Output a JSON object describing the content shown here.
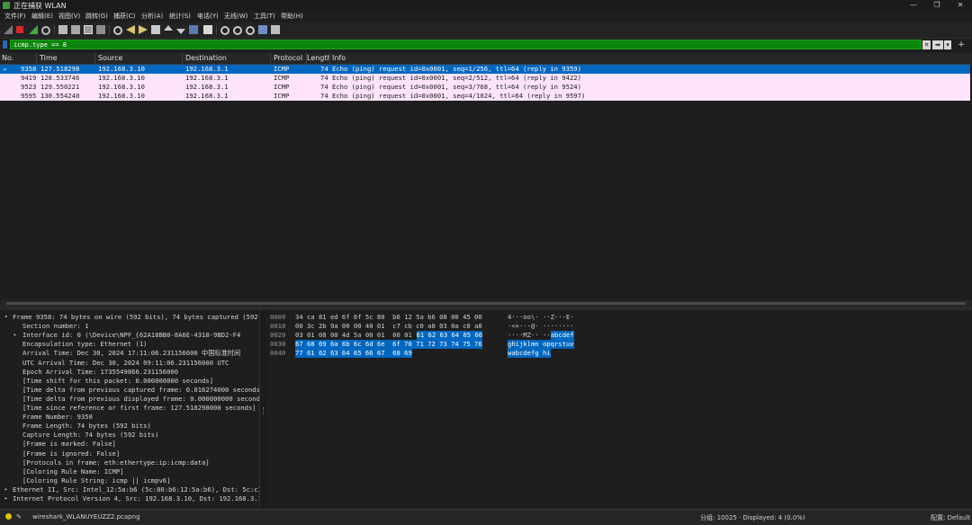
{
  "window": {
    "title": "正在捕获 WLAN",
    "min": "—",
    "max": "❐",
    "close": "✕"
  },
  "menu": [
    "文件(F)",
    "编辑(E)",
    "视图(V)",
    "跳转(G)",
    "捕获(C)",
    "分析(A)",
    "统计(S)",
    "电话(Y)",
    "无线(W)",
    "工具(T)",
    "帮助(H)"
  ],
  "filter": {
    "value": "icmp.type == 8",
    "clear_label": "✕",
    "apply_label": "➡",
    "dropdown_label": "▾",
    "add_label": "+"
  },
  "packet_list": {
    "columns": [
      "No.",
      "Time",
      "Source",
      "Destination",
      "Protocol",
      "Length",
      "Info"
    ],
    "rows": [
      {
        "marker": "→",
        "no": "9358",
        "time": "127.518298",
        "source": "192.168.3.10",
        "destination": "192.168.3.1",
        "protocol": "ICMP",
        "length": "74",
        "info": "Echo (ping) request  id=0x0001, seq=1/256, ttl=64 (reply in 9359)"
      },
      {
        "marker": "",
        "no": "9419",
        "time": "128.533746",
        "source": "192.168.3.10",
        "destination": "192.168.3.1",
        "protocol": "ICMP",
        "length": "74",
        "info": "Echo (ping) request  id=0x0001, seq=2/512, ttl=64 (reply in 9422)"
      },
      {
        "marker": "",
        "no": "9523",
        "time": "129.550221",
        "source": "192.168.3.10",
        "destination": "192.168.3.1",
        "protocol": "ICMP",
        "length": "74",
        "info": "Echo (ping) request  id=0x0001, seq=3/768, ttl=64 (reply in 9524)"
      },
      {
        "marker": "",
        "no": "9595",
        "time": "130.554240",
        "source": "192.168.3.10",
        "destination": "192.168.3.1",
        "protocol": "ICMP",
        "length": "74",
        "info": "Echo (ping) request  id=0x0001, seq=4/1024, ttl=64 (reply in 9597)"
      }
    ]
  },
  "details": [
    {
      "arrow": "▾",
      "indent": 0,
      "text": "Frame 9358: 74 bytes on wire (592 bits), 74 bytes captured (592 bits) on interface"
    },
    {
      "arrow": "",
      "indent": 1,
      "text": "Section number: 1"
    },
    {
      "arrow": "▸",
      "indent": 1,
      "text": "Interface id: 0 (\\Device\\NPF_{62A18BB0-8A6E-4318-9BD2-F4"
    },
    {
      "arrow": "",
      "indent": 1,
      "text": "Encapsulation type: Ethernet (1)"
    },
    {
      "arrow": "",
      "indent": 1,
      "text": "Arrival Time: Dec 30, 2024 17:11:06.231156000 中国标准时间"
    },
    {
      "arrow": "",
      "indent": 1,
      "text": "UTC Arrival Time: Dec 30, 2024 09:11:06.231156000 UTC"
    },
    {
      "arrow": "",
      "indent": 1,
      "text": "Epoch Arrival Time: 1735549866.231156000"
    },
    {
      "arrow": "",
      "indent": 1,
      "text": "[Time shift for this packet: 0.000000000 seconds]"
    },
    {
      "arrow": "",
      "indent": 1,
      "text": "[Time delta from previous captured frame: 0.016274000 seconds]"
    },
    {
      "arrow": "",
      "indent": 1,
      "text": "[Time delta from previous displayed frame: 0.000000000 seconds]"
    },
    {
      "arrow": "",
      "indent": 1,
      "text": "[Time since reference or first frame: 127.518298000 seconds]"
    },
    {
      "arrow": "",
      "indent": 1,
      "text": "Frame Number: 9358"
    },
    {
      "arrow": "",
      "indent": 1,
      "text": "Frame Length: 74 bytes (592 bits)"
    },
    {
      "arrow": "",
      "indent": 1,
      "text": "Capture Length: 74 bytes (592 bits)"
    },
    {
      "arrow": "",
      "indent": 1,
      "text": "[Frame is marked: False]"
    },
    {
      "arrow": "",
      "indent": 1,
      "text": "[Frame is ignored: False]"
    },
    {
      "arrow": "",
      "indent": 1,
      "text": "[Protocols in frame: eth:ethertype:ip:icmp:data]"
    },
    {
      "arrow": "",
      "indent": 1,
      "text": "[Coloring Rule Name: ICMP]"
    },
    {
      "arrow": "",
      "indent": 1,
      "text": "[Coloring Rule String: icmp || icmpv6]"
    },
    {
      "arrow": "▸",
      "indent": 0,
      "text": "Ethernet II, Src: Intel_12:5a:b6 (5c:80:b6:12:5a:b6), Dst: 5c:c3:07:3b:9a:00"
    },
    {
      "arrow": "▸",
      "indent": 0,
      "text": "Internet Protocol Version 4, Src: 192.168.3.10, Dst: 192.168.3.1"
    }
  ],
  "bytes": [
    {
      "offset": "0000",
      "hex_plain": "34 ca 81 ed 6f 6f 5c 80  b6 12 5a b6 08 00 45 00",
      "hex_hl": "",
      "ascii_plain": "4···oo\\· ··Z···E·",
      "ascii_hl": ""
    },
    {
      "offset": "0010",
      "hex_plain": "00 3c 2b 9a 00 00 40 01  c7 cb c0 a8 03 0a c0 a8",
      "hex_hl": "",
      "ascii_plain": "·<+···@· ········",
      "ascii_hl": ""
    },
    {
      "offset": "0020",
      "hex_plain": "03 01 08 00 4d 5a 00 01  00 01 ",
      "hex_hl": "61 62 63 64 65 66",
      "ascii_plain": "····MZ·· ··",
      "ascii_hl": "abcdef"
    },
    {
      "offset": "0030",
      "hex_plain": "",
      "hex_hl": "67 68 69 6a 6b 6c 6d 6e  6f 70 71 72 73 74 75 76",
      "ascii_plain": "",
      "ascii_hl": "ghijklmn opqrstuv"
    },
    {
      "offset": "0040",
      "hex_plain": "",
      "hex_hl": "77 61 62 63 64 65 66 67  68 69",
      "ascii_plain": "",
      "ascii_hl": "wabcdefg hi"
    }
  ],
  "status": {
    "file": "wireshark_WLANUYEUZZ2.pcapng",
    "counts": "分组: 10025 · Displayed: 4 (0.0%)",
    "profile": "配置: Default"
  },
  "colors": {
    "selected_row": "#0067c0",
    "icmp_row": "#fde4fb",
    "filter_ok": "#0c850c",
    "byte_highlight": "#0067c0"
  }
}
